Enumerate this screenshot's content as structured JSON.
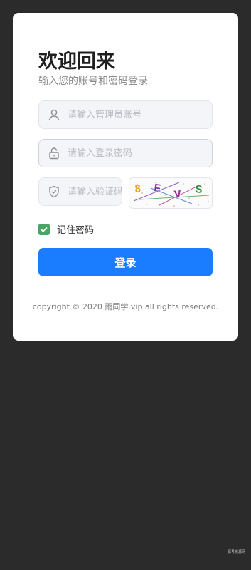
{
  "header": {
    "title": "欢迎回来",
    "subtitle": "输入您的账号和密码登录"
  },
  "form": {
    "username_placeholder": "请输入管理员账号",
    "password_placeholder": "请输入登录密码",
    "captcha_placeholder": "请输入验证码",
    "captcha_text": [
      "8",
      "F",
      "V",
      "S"
    ],
    "captcha_colors": [
      "#e3a21a",
      "#7b2fb0",
      "#a0289a",
      "#2e8b3a"
    ],
    "remember_label": "记住密码",
    "remember_checked": true,
    "login_label": "登录"
  },
  "footer": {
    "copyright": "copyright © 2020 雨同学.vip all rights reserved."
  },
  "watermark": "源号资源网",
  "colors": {
    "background": "#2b2b2b",
    "card": "#ffffff",
    "primary": "#1a7cff",
    "checkbox": "#4aa466"
  }
}
